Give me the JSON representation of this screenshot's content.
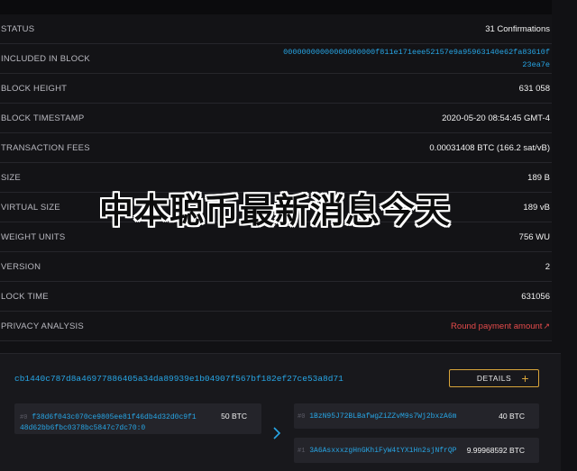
{
  "rows": [
    {
      "label": "STATUS",
      "value": "31 Confirmations"
    },
    {
      "label": "INCLUDED IN BLOCK",
      "value": "00000000000000000000f811e171eee52157e9a95963140e62fa83610f23ea7e"
    },
    {
      "label": "BLOCK HEIGHT",
      "value": "631 058"
    },
    {
      "label": "BLOCK TIMESTAMP",
      "value": "2020-05-20 08:54:45 GMT-4"
    },
    {
      "label": "TRANSACTION FEES",
      "value": "0.00031408 BTC (166.2 sat/vB)"
    },
    {
      "label": "SIZE",
      "value": "189 B"
    },
    {
      "label": "VIRTUAL SIZE",
      "value": "189 vB"
    },
    {
      "label": "WEIGHT UNITS",
      "value": "756 WU"
    },
    {
      "label": "VERSION",
      "value": "2"
    },
    {
      "label": "LOCK TIME",
      "value": "631056"
    },
    {
      "label": "PRIVACY ANALYSIS",
      "value": "Round payment amount"
    }
  ],
  "watermark": "中本聪币最新消息今天",
  "transaction": {
    "hash": "cb1440c787d8a46977886405a34da89939e1b04907f567bf182ef27ce53a8d71",
    "details_label": "DETAILS",
    "details_icon": "plus-icon",
    "arrow_icon": "chevron-right-icon",
    "inputs": [
      {
        "index": "#0",
        "address": "f38d6f043c070ce9805ee81f46db4d32d0c9f148d62bb6fbc0378bc5847c7dc70:0",
        "amount": "50 BTC"
      }
    ],
    "outputs": [
      {
        "index": "#0",
        "address": "1BzN95J72BLBafwgZiZZvM9s7Wj2bxzA6m",
        "amount": "40 BTC"
      },
      {
        "index": "#1",
        "address": "3A6AsxxxzgHnGKhiFyW4tYX1Hn2sjNfrQP",
        "amount": "9.99968592 BTC"
      }
    ]
  },
  "colors": {
    "link": "#27a6e6",
    "warning": "#e54b4b",
    "accent": "#d9a53a"
  }
}
